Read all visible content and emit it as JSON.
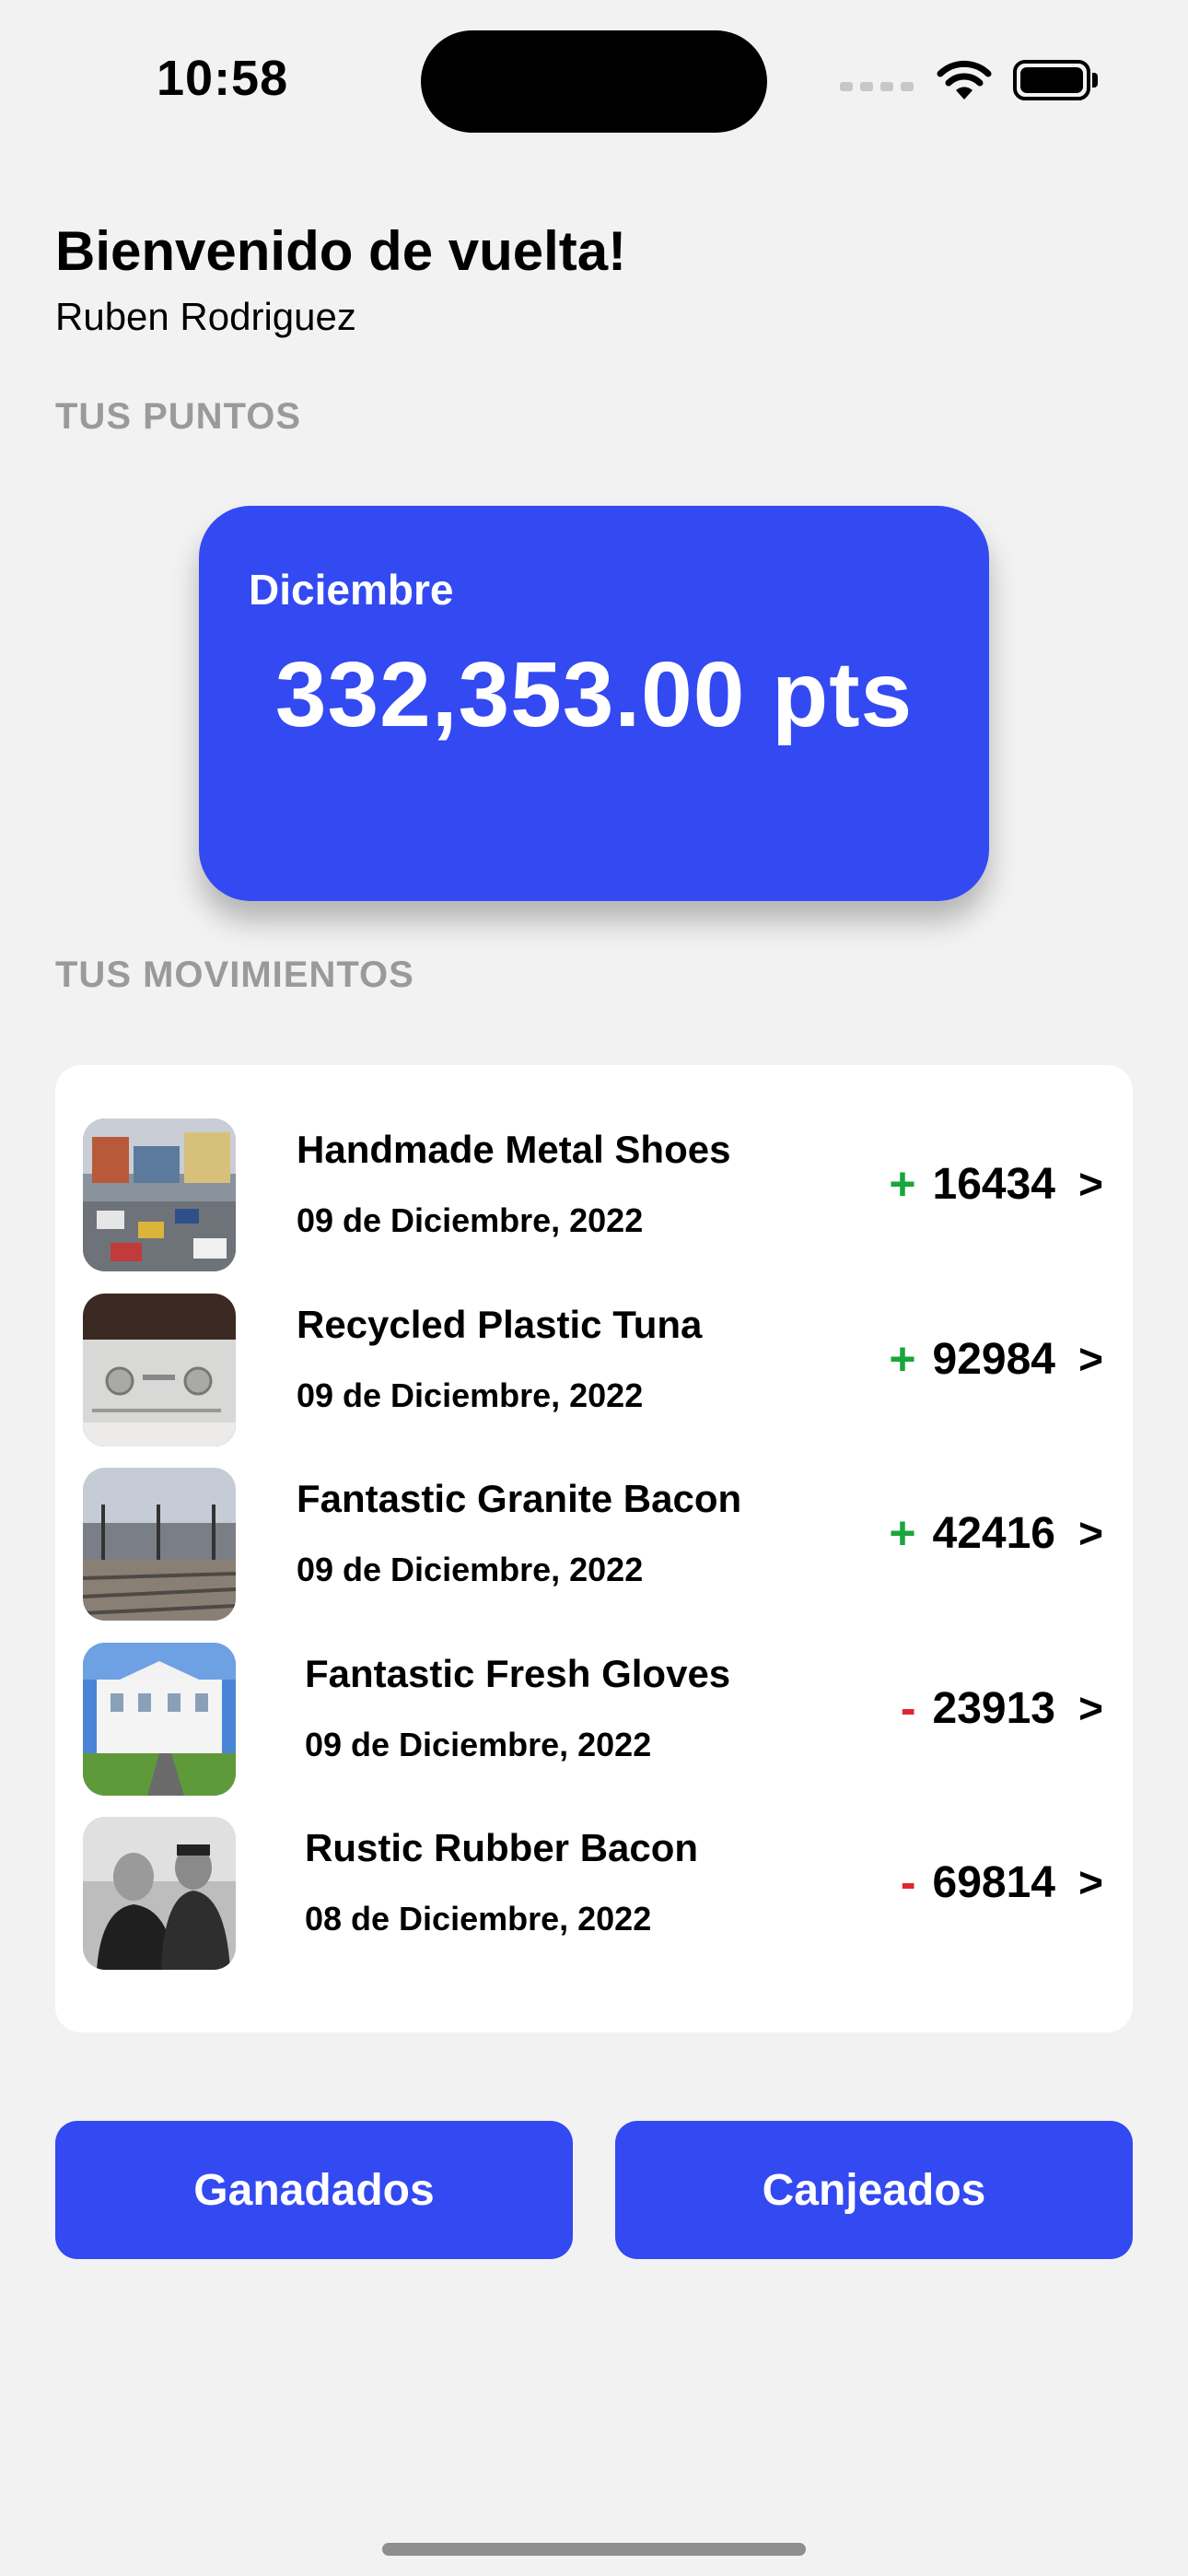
{
  "status_bar": {
    "time": "10:58"
  },
  "header": {
    "welcome": "Bienvenido de vuelta!",
    "user_name": "Ruben Rodriguez"
  },
  "points": {
    "section_label": "TUS PUNTOS",
    "month": "Diciembre",
    "value": "332,353.00 pts"
  },
  "movements": {
    "section_label": "TUS MOVIMIENTOS",
    "items": [
      {
        "title": "Handmade Metal Shoes",
        "date": "09 de Diciembre, 2022",
        "sign": "+",
        "amount": "16434",
        "chevron": ">",
        "thumbnail": "street-traffic-photo"
      },
      {
        "title": "Recycled Plastic Tuna",
        "date": "09 de Diciembre, 2022",
        "sign": "+",
        "amount": "92984",
        "chevron": ">",
        "thumbnail": "audio-amplifier-photo"
      },
      {
        "title": "Fantastic Granite Bacon",
        "date": "09 de Diciembre, 2022",
        "sign": "+",
        "amount": "42416",
        "chevron": ">",
        "thumbnail": "train-platform-photo"
      },
      {
        "title": "Fantastic Fresh Gloves",
        "date": "09 de Diciembre, 2022",
        "sign": "-",
        "amount": "23913",
        "chevron": ">",
        "thumbnail": "white-building-photo"
      },
      {
        "title": "Rustic Rubber Bacon",
        "date": "08 de Diciembre, 2022",
        "sign": "-",
        "amount": "69814",
        "chevron": ">",
        "thumbnail": "people-bw-photo"
      }
    ]
  },
  "buttons": {
    "earned": "Ganadados",
    "redeemed": "Canjeados"
  },
  "colors": {
    "accent": "#3349f2",
    "positive": "#19a63a",
    "negative": "#e0262c",
    "background": "#f2f2f2"
  }
}
